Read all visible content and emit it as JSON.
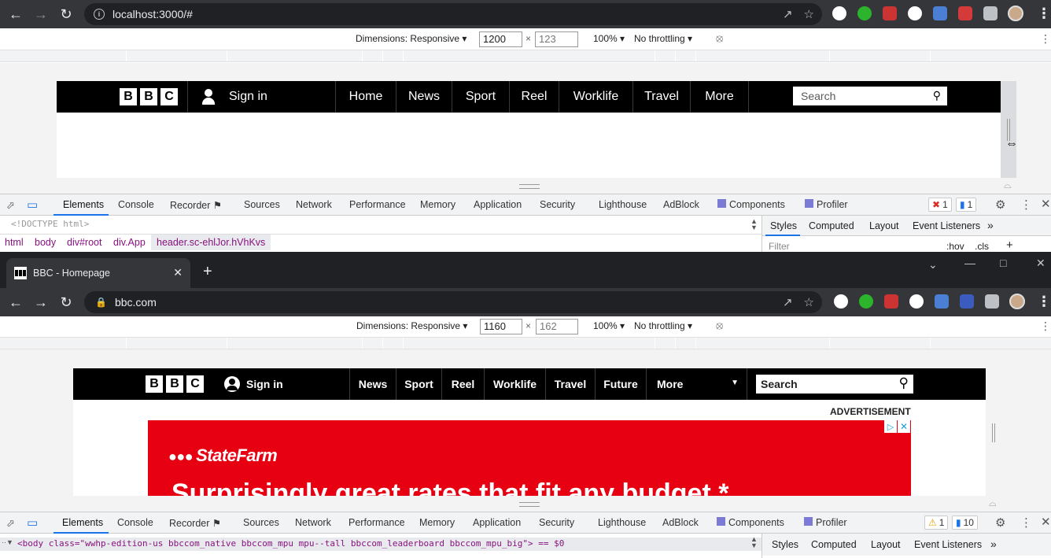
{
  "top": {
    "url": "localhost:3000/#",
    "device": {
      "dimensions_label": "Dimensions: Responsive",
      "width": "1200",
      "height": "123",
      "zoom": "100%",
      "throttling": "No throttling"
    },
    "bbc": {
      "logo_letters": [
        "B",
        "B",
        "C"
      ],
      "signin": "Sign in",
      "nav": [
        "Home",
        "News",
        "Sport",
        "Reel",
        "Worklife",
        "Travel",
        "More"
      ],
      "search_placeholder": "Search"
    },
    "devtools": {
      "tabs": [
        "Elements",
        "Console",
        "Recorder",
        "Sources",
        "Network",
        "Performance",
        "Memory",
        "Application",
        "Security",
        "Lighthouse",
        "AdBlock",
        "Components",
        "Profiler"
      ],
      "errors": "1",
      "messages": "1",
      "doctype": "<!DOCTYPE html>",
      "breadcrumbs": [
        "html",
        "body",
        "div#root",
        "div.App",
        "header.sc-ehlJor.hVhKvs"
      ],
      "styles_tabs": [
        "Styles",
        "Computed",
        "Layout",
        "Event Listeners"
      ],
      "filter_placeholder": "Filter",
      "hov": ":hov",
      "cls": ".cls"
    }
  },
  "bottom": {
    "tab_title": "BBC - Homepage",
    "url": "bbc.com",
    "device": {
      "dimensions_label": "Dimensions: Responsive",
      "width": "1160",
      "height": "162",
      "zoom": "100%",
      "throttling": "No throttling"
    },
    "bbc": {
      "logo_letters": [
        "B",
        "B",
        "C"
      ],
      "signin": "Sign in",
      "nav": [
        "News",
        "Sport",
        "Reel",
        "Worklife",
        "Travel",
        "Future",
        "More"
      ],
      "search_placeholder": "Search",
      "advertisement_label": "ADVERTISEMENT",
      "ad_brand": "StateFarm",
      "ad_headline": "Surprisingly great rates that fit any budget.*"
    },
    "devtools": {
      "tabs": [
        "Elements",
        "Console",
        "Recorder",
        "Sources",
        "Network",
        "Performance",
        "Memory",
        "Application",
        "Security",
        "Lighthouse",
        "AdBlock",
        "Components",
        "Profiler"
      ],
      "warnings": "1",
      "messages": "10",
      "body_line": "<body class=\"wwhp-edition-us bbccom_native bbccom_mpu mpu--tall bbccom_leaderboard  bbccom_mpu_big\"> == $0",
      "styles_tabs": [
        "Styles",
        "Computed",
        "Layout",
        "Event Listeners"
      ]
    }
  },
  "colors": {
    "chrome_dark": "#35363a",
    "bbc_black": "#000000",
    "ad_red": "#e60012",
    "devtools_blue": "#1a73e8"
  }
}
